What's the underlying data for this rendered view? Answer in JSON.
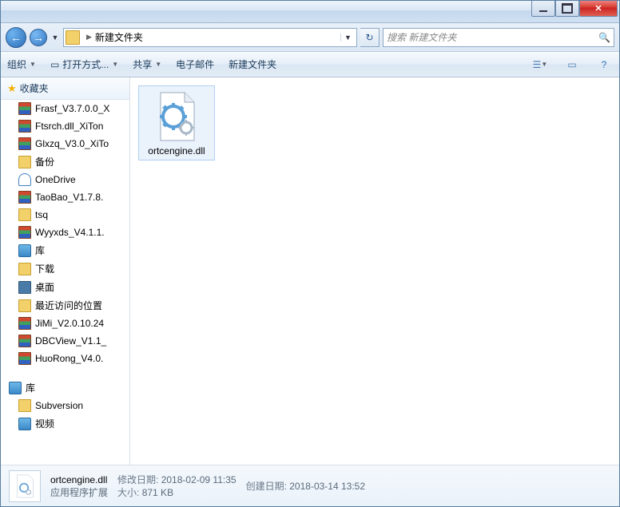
{
  "titlebar": {},
  "address": {
    "folder_name": "新建文件夹",
    "search_placeholder": "搜索 新建文件夹"
  },
  "toolbar": {
    "organize": "组织",
    "open_with": "打开方式...",
    "share": "共享",
    "email": "电子邮件",
    "new_folder": "新建文件夹"
  },
  "sidebar": {
    "favorites_header": "收藏夹",
    "items": [
      {
        "label": "Frasf_V3.7.0.0_X",
        "icon": "rar"
      },
      {
        "label": "Ftsrch.dll_XiTon",
        "icon": "rar"
      },
      {
        "label": "Glxzq_V3.0_XiTo",
        "icon": "rar"
      },
      {
        "label": "备份",
        "icon": "folder"
      },
      {
        "label": "OneDrive",
        "icon": "cloud"
      },
      {
        "label": "TaoBao_V1.7.8.",
        "icon": "rar"
      },
      {
        "label": "tsq",
        "icon": "folder"
      },
      {
        "label": "Wyyxds_V4.1.1.",
        "icon": "rar"
      },
      {
        "label": "库",
        "icon": "lib"
      },
      {
        "label": "下载",
        "icon": "folder"
      },
      {
        "label": "桌面",
        "icon": "desk"
      },
      {
        "label": "最近访问的位置",
        "icon": "folder"
      },
      {
        "label": "JiMi_V2.0.10.24",
        "icon": "rar"
      },
      {
        "label": "DBCView_V1.1_",
        "icon": "rar"
      },
      {
        "label": "HuoRong_V4.0.",
        "icon": "rar"
      }
    ],
    "library_header": "库",
    "library_items": [
      {
        "label": "Subversion",
        "icon": "folder"
      },
      {
        "label": "视频",
        "icon": "lib"
      }
    ]
  },
  "content": {
    "file": {
      "name": "ortcengine.dll"
    }
  },
  "details": {
    "filename": "ortcengine.dll",
    "type": "应用程序扩展",
    "modified_label": "修改日期:",
    "modified": "2018-02-09 11:35",
    "size_label": "大小:",
    "size": "871 KB",
    "created_label": "创建日期:",
    "created": "2018-03-14 13:52"
  }
}
